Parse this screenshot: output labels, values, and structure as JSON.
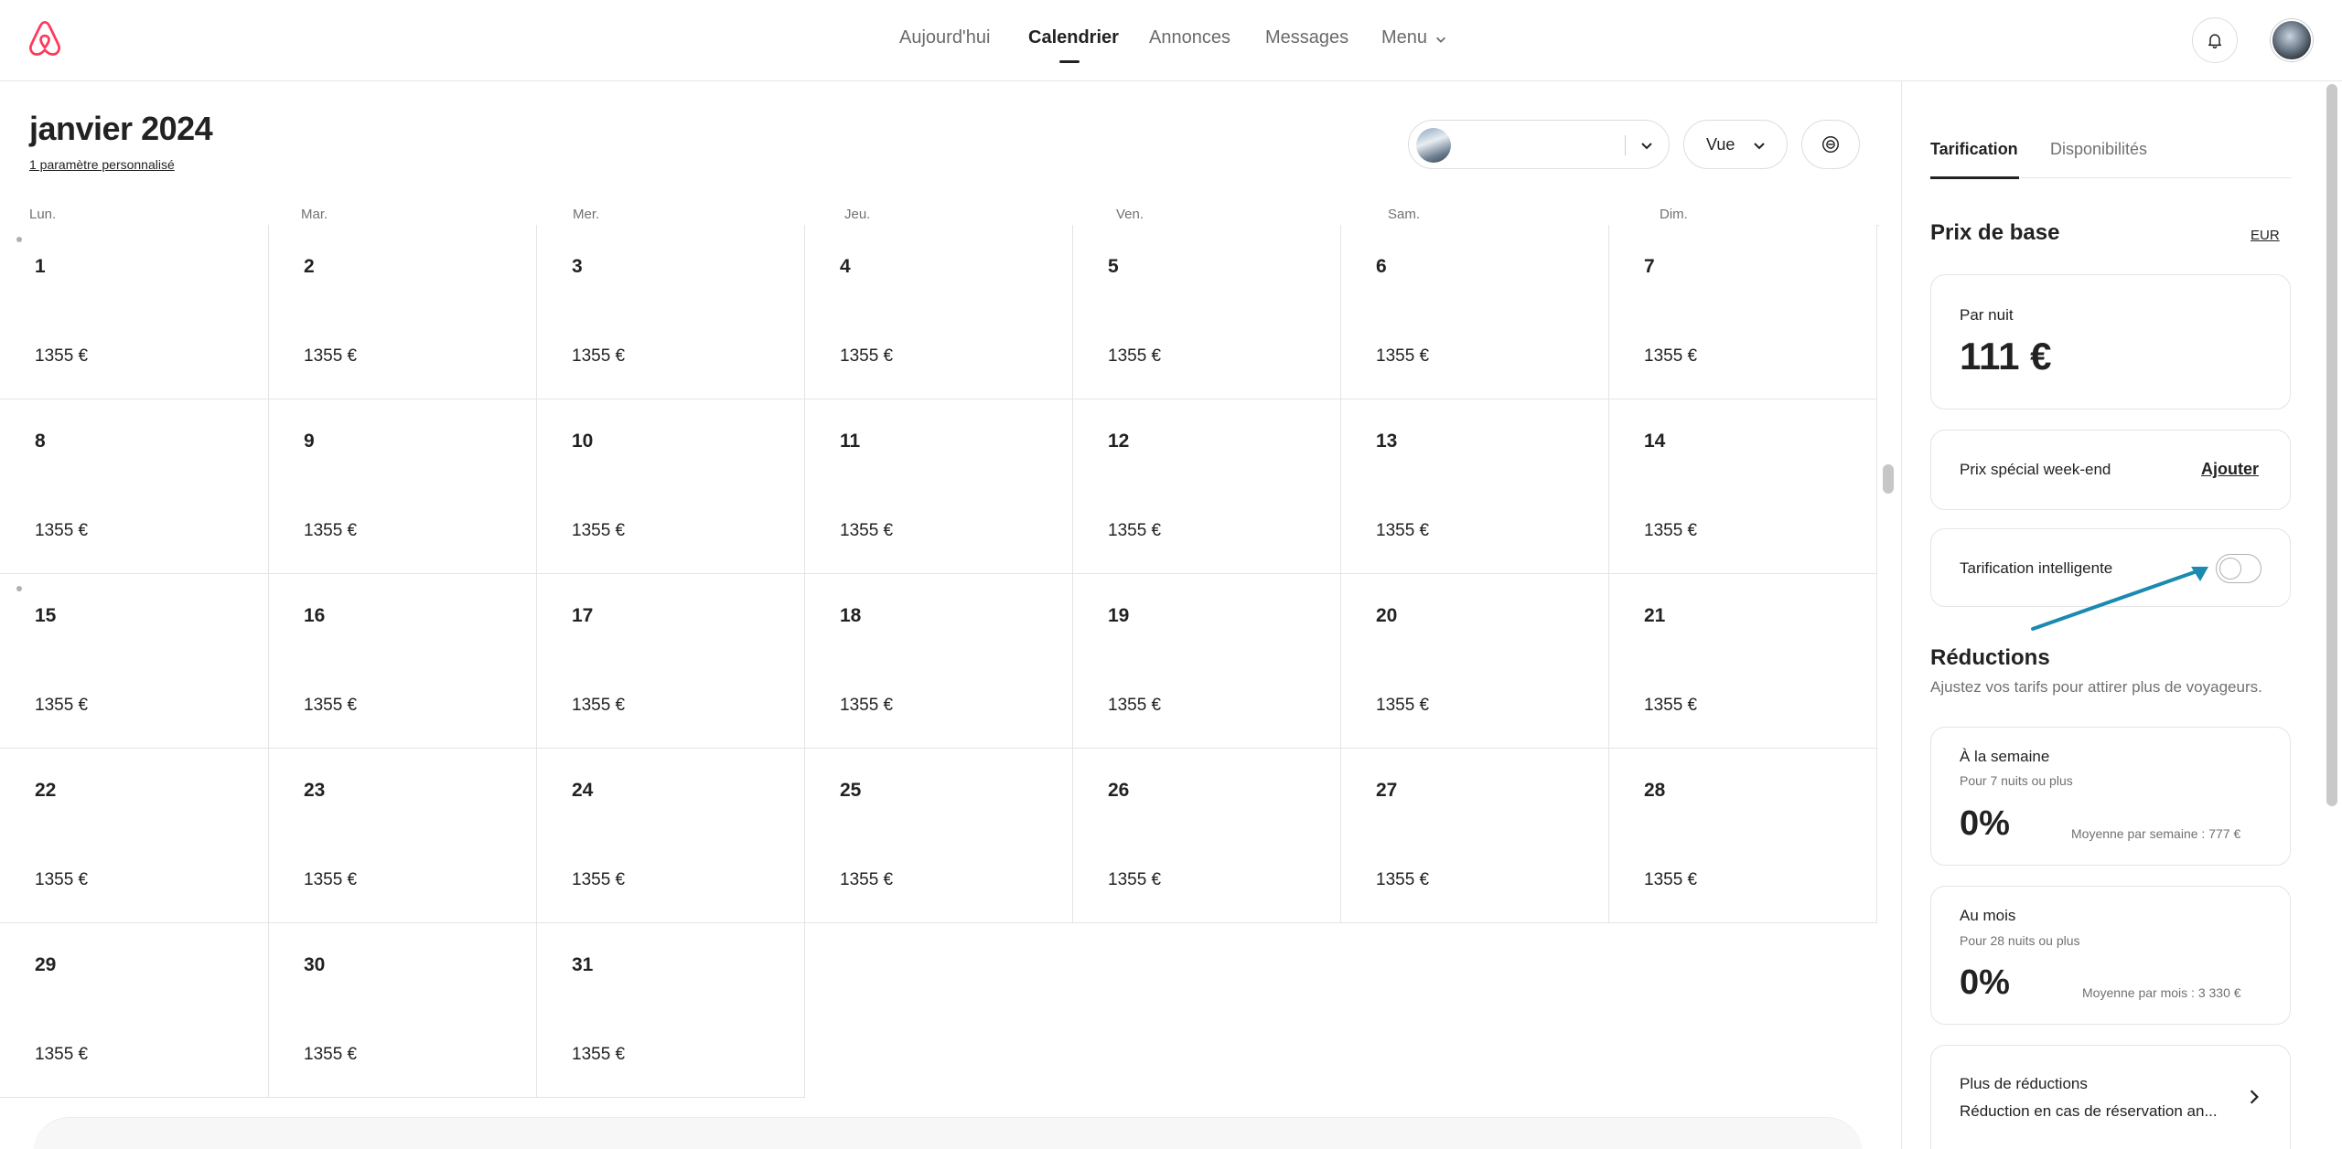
{
  "header": {
    "nav": [
      {
        "label": "Aujourd'hui",
        "active": false
      },
      {
        "label": "Calendrier",
        "active": true
      },
      {
        "label": "Annonces",
        "active": false
      },
      {
        "label": "Messages",
        "active": false
      },
      {
        "label": "Menu",
        "active": false
      }
    ]
  },
  "calendar": {
    "title": "janvier 2024",
    "subtitle": "1 paramètre personnalisé",
    "view_label": "Vue",
    "weekdays": [
      "Lun.",
      "Mar.",
      "Mer.",
      "Jeu.",
      "Ven.",
      "Sam.",
      "Dim."
    ],
    "days": [
      {
        "day": "1",
        "price": "1355 €"
      },
      {
        "day": "2",
        "price": "1355 €"
      },
      {
        "day": "3",
        "price": "1355 €"
      },
      {
        "day": "4",
        "price": "1355 €"
      },
      {
        "day": "5",
        "price": "1355 €"
      },
      {
        "day": "6",
        "price": "1355 €"
      },
      {
        "day": "7",
        "price": "1355 €"
      },
      {
        "day": "8",
        "price": "1355 €"
      },
      {
        "day": "9",
        "price": "1355 €"
      },
      {
        "day": "10",
        "price": "1355 €"
      },
      {
        "day": "11",
        "price": "1355 €"
      },
      {
        "day": "12",
        "price": "1355 €"
      },
      {
        "day": "13",
        "price": "1355 €"
      },
      {
        "day": "14",
        "price": "1355 €"
      },
      {
        "day": "15",
        "price": "1355 €"
      },
      {
        "day": "16",
        "price": "1355 €"
      },
      {
        "day": "17",
        "price": "1355 €"
      },
      {
        "day": "18",
        "price": "1355 €"
      },
      {
        "day": "19",
        "price": "1355 €"
      },
      {
        "day": "20",
        "price": "1355 €"
      },
      {
        "day": "21",
        "price": "1355 €"
      },
      {
        "day": "22",
        "price": "1355 €"
      },
      {
        "day": "23",
        "price": "1355 €"
      },
      {
        "day": "24",
        "price": "1355 €"
      },
      {
        "day": "25",
        "price": "1355 €"
      },
      {
        "day": "26",
        "price": "1355 €"
      },
      {
        "day": "27",
        "price": "1355 €"
      },
      {
        "day": "28",
        "price": "1355 €"
      },
      {
        "day": "29",
        "price": "1355 €"
      },
      {
        "day": "30",
        "price": "1355 €"
      },
      {
        "day": "31",
        "price": "1355 €"
      }
    ]
  },
  "panel": {
    "tabs": [
      "Tarification",
      "Disponibilités"
    ],
    "base_price_title": "Prix de base",
    "currency": "EUR",
    "per_night_label": "Par nuit",
    "per_night_value": "111 €",
    "weekend_label": "Prix spécial week-end",
    "weekend_action": "Ajouter",
    "smart_pricing_label": "Tarification intelligente",
    "smart_pricing_on": false,
    "discounts_title": "Réductions",
    "discounts_desc": "Ajustez vos tarifs pour attirer plus de voyageurs.",
    "weekly": {
      "title": "À la semaine",
      "desc": "Pour 7 nuits ou plus",
      "pct": "0%",
      "avg": "Moyenne par semaine : 777 €"
    },
    "monthly": {
      "title": "Au mois",
      "desc": "Pour 28 nuits ou plus",
      "pct": "0%",
      "avg": "Moyenne par mois : 3 330 €"
    },
    "more": {
      "title": "Plus de réductions",
      "desc": "Réduction en cas de réservation an..."
    }
  },
  "colors": {
    "brand": "#FF385C",
    "annotation_arrow": "#1A8AB0",
    "text": "#222222",
    "muted": "#717171"
  }
}
